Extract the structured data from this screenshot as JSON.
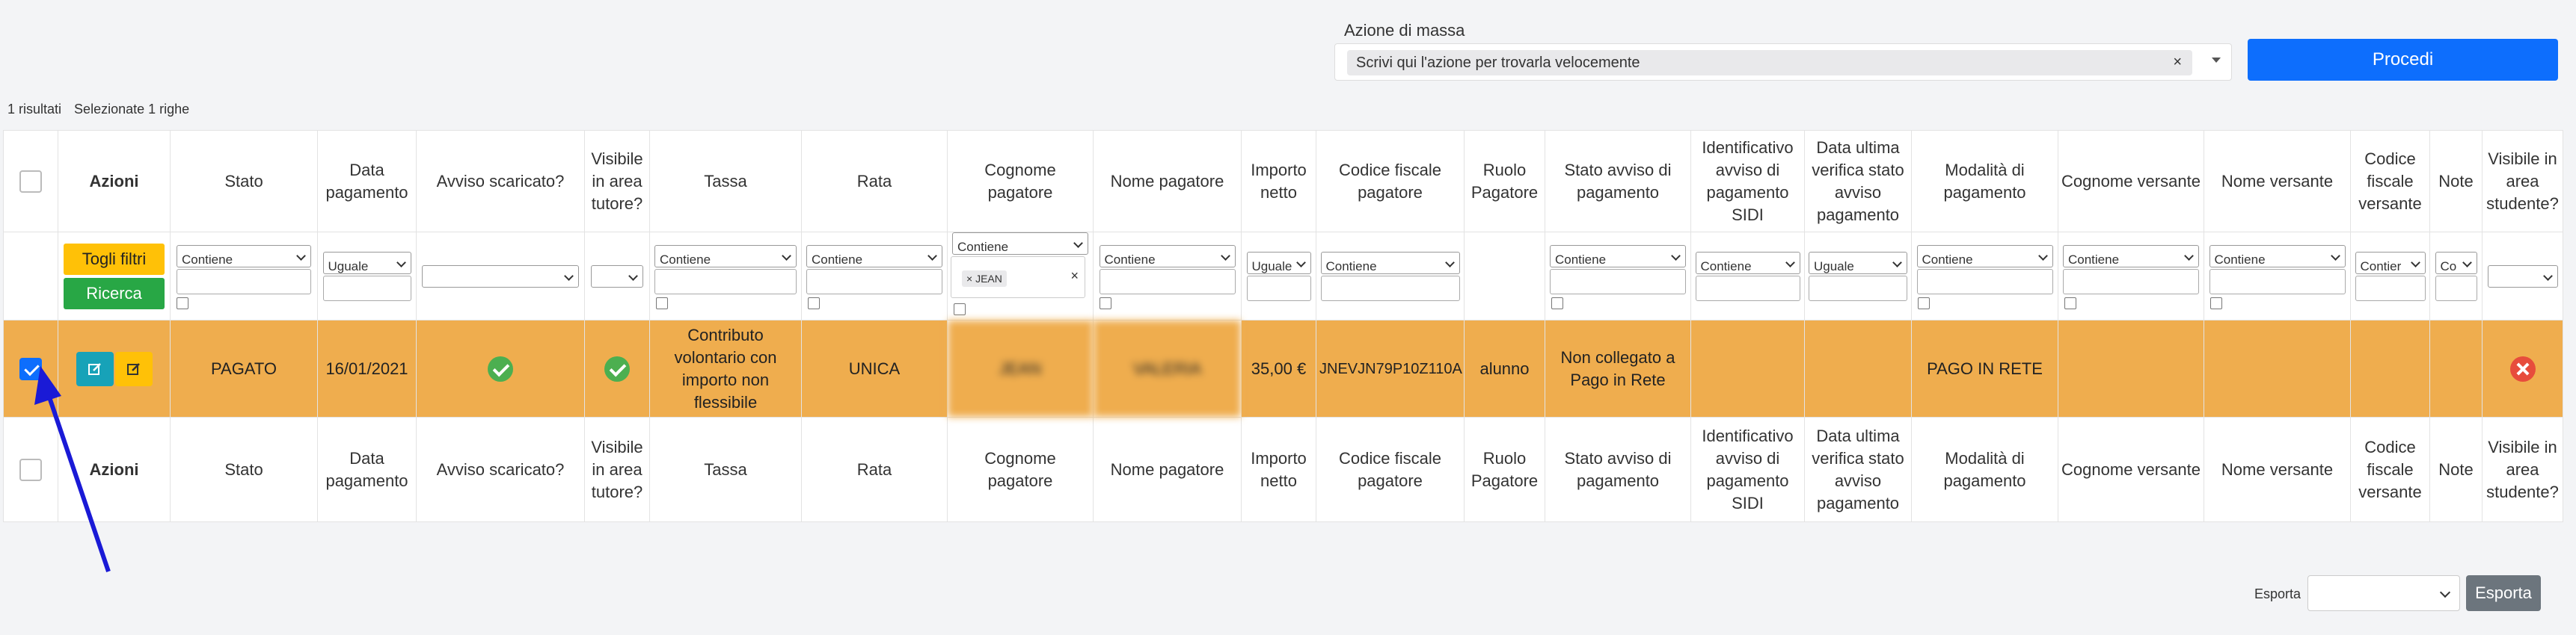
{
  "mass_action": {
    "label": "Azione di massa",
    "placeholder_chip": "Scrivi qui l'azione per trovarla velocemente",
    "clear": "×",
    "submit": "Procedi"
  },
  "results": {
    "count": "1 risultati",
    "selected": "Selezionate 1 righe"
  },
  "columns": {
    "azioni": "Azioni",
    "stato": "Stato",
    "data_pagamento": "Data pagamento",
    "avviso_scaricato": "Avviso scaricato?",
    "visibile_tutore": "Visibile in area tutore?",
    "tassa": "Tassa",
    "rata": "Rata",
    "cognome_pagatore": "Cognome pagatore",
    "nome_pagatore": "Nome pagatore",
    "importo_netto": "Importo netto",
    "codice_fiscale_pagatore": "Codice fiscale pagatore",
    "ruolo_pagatore": "Ruolo Pagatore",
    "stato_avviso": "Stato avviso di pagamento",
    "id_avviso_sidi": "Identificativo avviso di pagamento SIDI",
    "data_ultima_verifica": "Data ultima verifica stato avviso pagamento",
    "modalita_pagamento": "Modalità di pagamento",
    "cognome_versante": "Cognome versante",
    "nome_versante": "Nome versante",
    "codice_fiscale_versante": "Codice fiscale versante",
    "note": "Note",
    "visibile_studente": "Visibile in area studente?"
  },
  "filters": {
    "toggle": "Togli filtri",
    "search": "Ricerca",
    "contiene": "Contiene",
    "uguale": "Uguale",
    "contiene_short": "Contier",
    "co_short": "Co",
    "tag_value": "JEAN",
    "tag_remove": "×",
    "tag_clear": "×"
  },
  "row": {
    "stato": "PAGATO",
    "data_pagamento": "16/01/2021",
    "tassa": "Contributo volontario con importo non flessibile",
    "rata": "UNICA",
    "cognome_pagatore": "JEAN",
    "nome_pagatore": "VALERIA",
    "importo_netto": "35,00 €",
    "codice_fiscale": "JNEVJN79P10Z110A",
    "ruolo": "alunno",
    "stato_avviso": "Non collegato a Pago in Rete",
    "modalita": "PAGO IN RETE"
  },
  "export": {
    "label": "Esporta",
    "button": "Esporta"
  },
  "colors": {
    "row_highlight": "#efad4e",
    "primary": "#0d6efd",
    "warning": "#ffc107",
    "success": "#28a745"
  }
}
